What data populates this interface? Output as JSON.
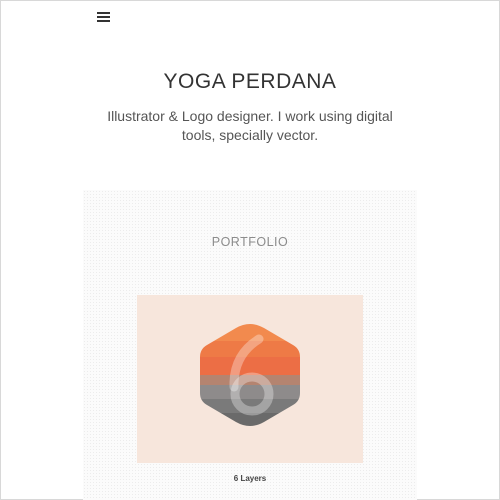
{
  "header": {
    "menu_icon": "hamburger-menu-icon"
  },
  "site": {
    "title": "YOGA PERDANA",
    "description": "Illustrator & Logo designer. I work using digital tools, specially vector."
  },
  "portfolio": {
    "heading": "PORTFOLIO",
    "items": [
      {
        "caption": "6 Layers",
        "thumbnail_icon": "six-hexagon-logo-icon",
        "card_color": "#f7e6dc",
        "layer_colors": [
          "#f28a4e",
          "#ee7a46",
          "#ec6e45",
          "#b48470",
          "#8e8b8b",
          "#7a7a7a",
          "#6a6a6a"
        ]
      }
    ]
  }
}
